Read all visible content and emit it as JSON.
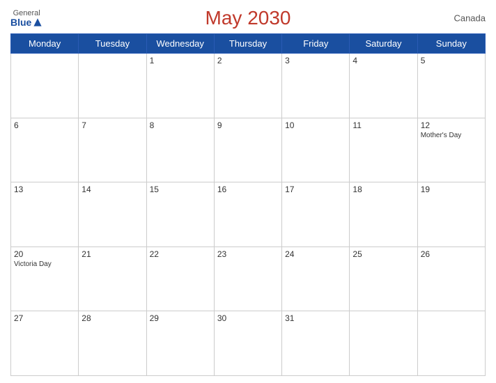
{
  "header": {
    "title": "May 2030",
    "country": "Canada",
    "logo_general": "General",
    "logo_blue": "Blue"
  },
  "weekdays": [
    "Monday",
    "Tuesday",
    "Wednesday",
    "Thursday",
    "Friday",
    "Saturday",
    "Sunday"
  ],
  "weeks": [
    [
      {
        "day": "",
        "events": []
      },
      {
        "day": "",
        "events": []
      },
      {
        "day": "1",
        "events": []
      },
      {
        "day": "2",
        "events": []
      },
      {
        "day": "3",
        "events": []
      },
      {
        "day": "4",
        "events": []
      },
      {
        "day": "5",
        "events": []
      }
    ],
    [
      {
        "day": "6",
        "events": []
      },
      {
        "day": "7",
        "events": []
      },
      {
        "day": "8",
        "events": []
      },
      {
        "day": "9",
        "events": []
      },
      {
        "day": "10",
        "events": []
      },
      {
        "day": "11",
        "events": []
      },
      {
        "day": "12",
        "events": [
          "Mother's Day"
        ]
      }
    ],
    [
      {
        "day": "13",
        "events": []
      },
      {
        "day": "14",
        "events": []
      },
      {
        "day": "15",
        "events": []
      },
      {
        "day": "16",
        "events": []
      },
      {
        "day": "17",
        "events": []
      },
      {
        "day": "18",
        "events": []
      },
      {
        "day": "19",
        "events": []
      }
    ],
    [
      {
        "day": "20",
        "events": [
          "Victoria Day"
        ]
      },
      {
        "day": "21",
        "events": []
      },
      {
        "day": "22",
        "events": []
      },
      {
        "day": "23",
        "events": []
      },
      {
        "day": "24",
        "events": []
      },
      {
        "day": "25",
        "events": []
      },
      {
        "day": "26",
        "events": []
      }
    ],
    [
      {
        "day": "27",
        "events": []
      },
      {
        "day": "28",
        "events": []
      },
      {
        "day": "29",
        "events": []
      },
      {
        "day": "30",
        "events": []
      },
      {
        "day": "31",
        "events": []
      },
      {
        "day": "",
        "events": []
      },
      {
        "day": "",
        "events": []
      }
    ]
  ]
}
